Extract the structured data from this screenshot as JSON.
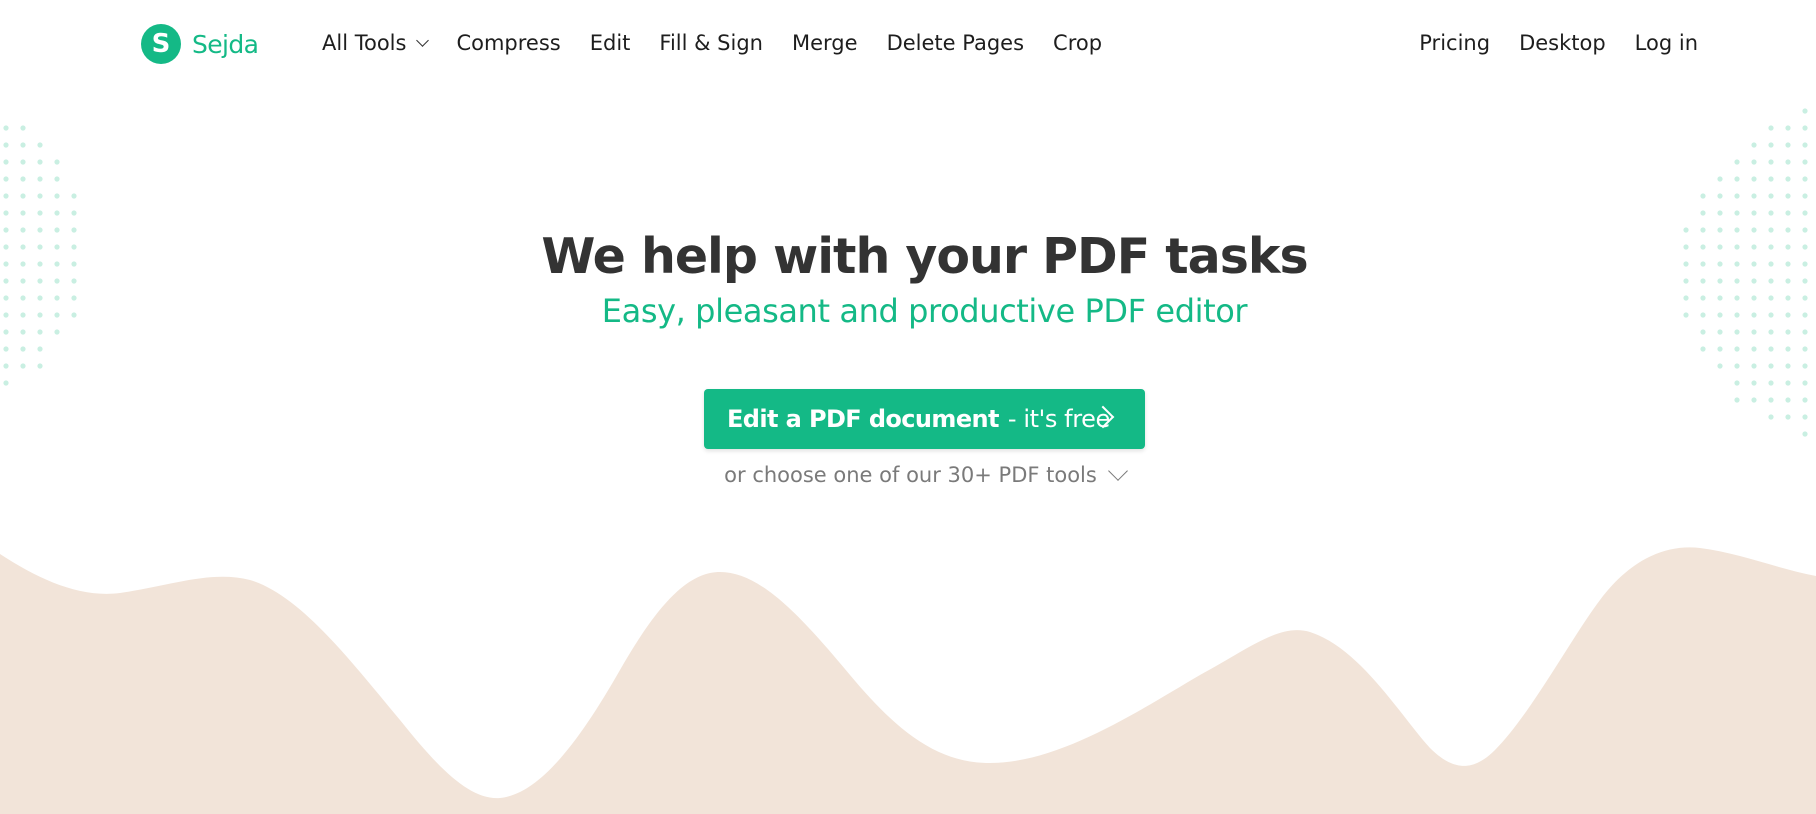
{
  "brand": {
    "name": "Sejda",
    "logo_letter": "S",
    "color": "#14b986"
  },
  "nav": {
    "left": [
      {
        "label": "All Tools",
        "has_dropdown": true,
        "icon": "chevron-down-icon"
      },
      {
        "label": "Compress"
      },
      {
        "label": "Edit"
      },
      {
        "label": "Fill & Sign"
      },
      {
        "label": "Merge"
      },
      {
        "label": "Delete Pages"
      },
      {
        "label": "Crop"
      }
    ],
    "right": [
      {
        "label": "Pricing"
      },
      {
        "label": "Desktop"
      },
      {
        "label": "Log in"
      }
    ]
  },
  "hero": {
    "title": "We help with your PDF tasks",
    "subtitle": "Easy, pleasant and productive PDF editor",
    "cta_strong": "Edit a PDF document",
    "cta_light": "- it's free",
    "cta_icon": "chevron-right-icon",
    "tools_link": "or choose one of our 30+ PDF tools",
    "tools_icon": "chevron-down-icon"
  },
  "colors": {
    "accent": "#14b986",
    "heading": "#333333",
    "muted": "#7a7a7a",
    "wave": "#f2e4d9",
    "dots": "#c9efe2"
  }
}
